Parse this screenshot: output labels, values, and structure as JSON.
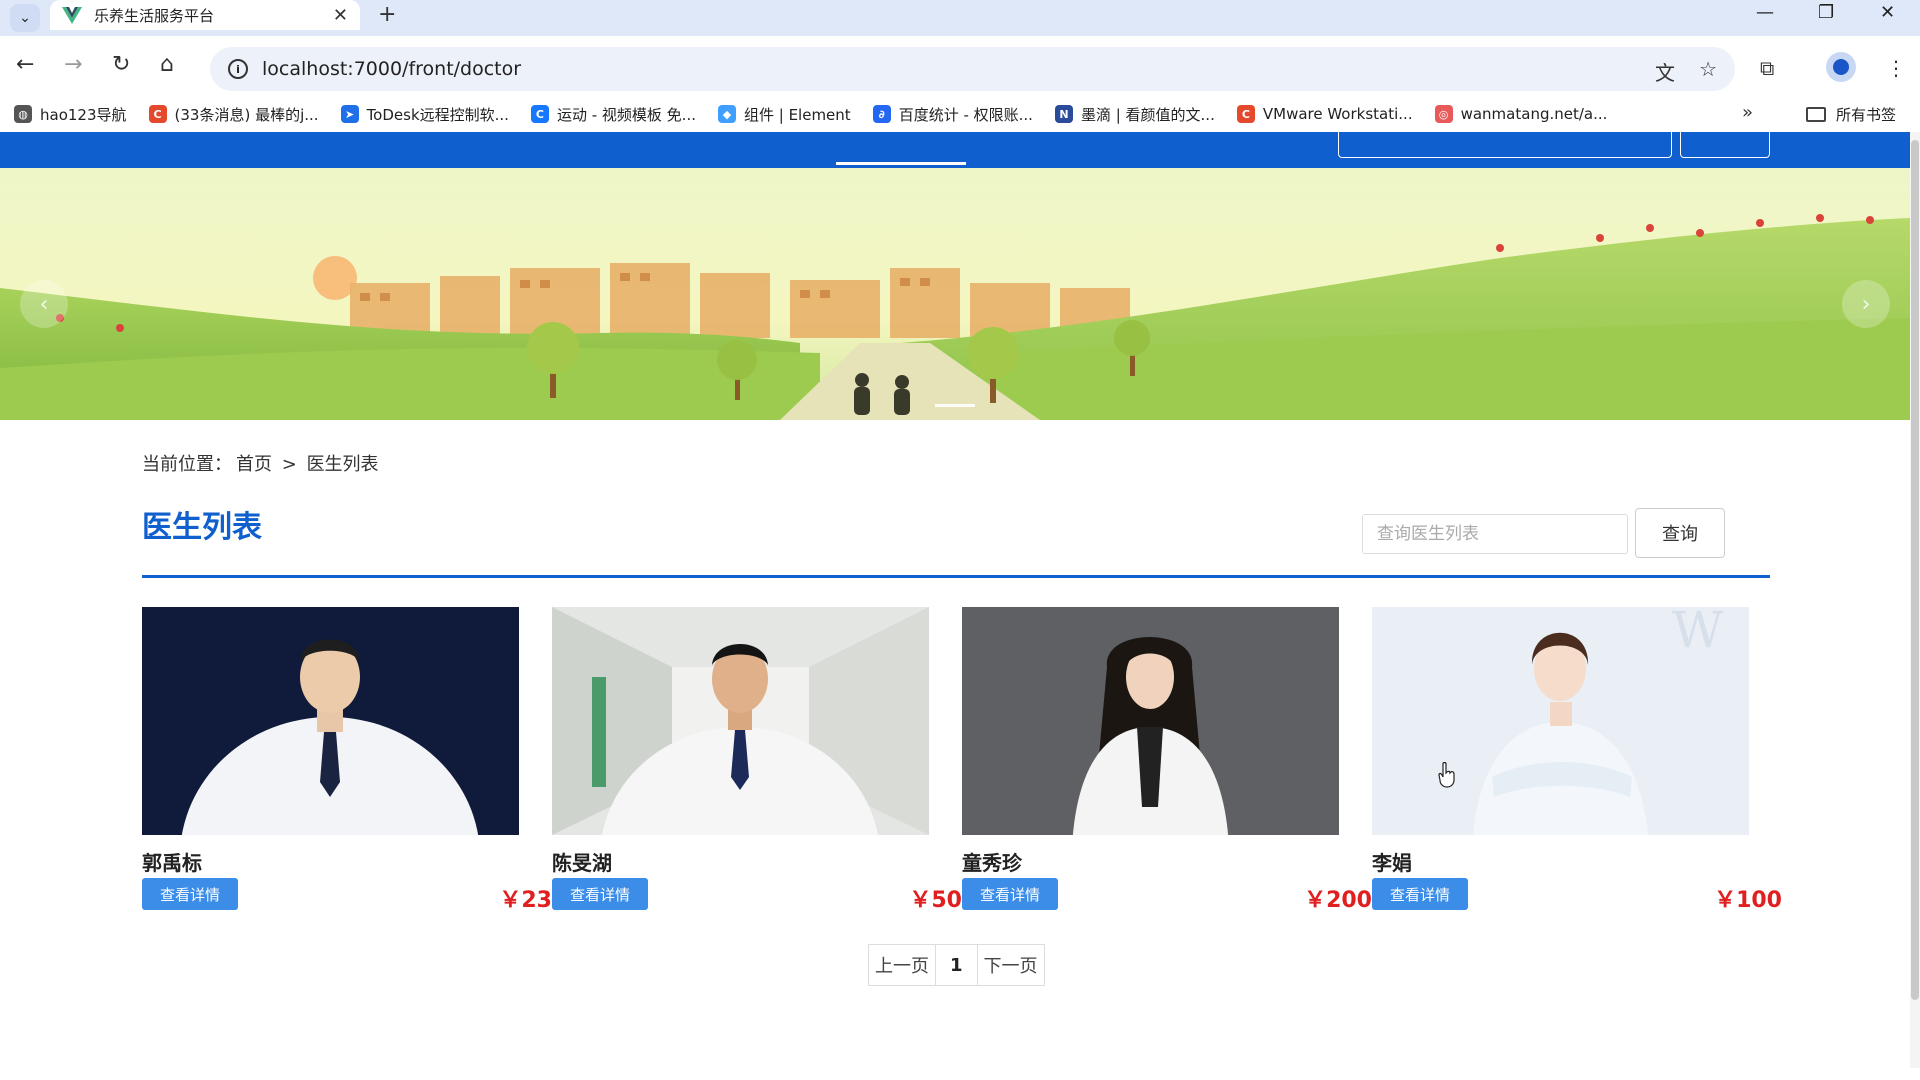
{
  "browser": {
    "tab_title": "乐养生活服务平台",
    "url": "localhost:7000/front/doctor",
    "bookmarks": [
      {
        "label": "hao123导航",
        "icon": "globe-icon",
        "color": "#555555"
      },
      {
        "label": "(33条消息) 最棒的j...",
        "icon": "csdn-icon",
        "color": "#e4492c"
      },
      {
        "label": "ToDesk远程控制软...",
        "icon": "todesk-icon",
        "color": "#1f6fe8"
      },
      {
        "label": "运动 - 视频模板 免...",
        "icon": "c-icon",
        "color": "#1677ff"
      },
      {
        "label": "组件 | Element",
        "icon": "element-icon",
        "color": "#409eff"
      },
      {
        "label": "百度统计 - 权限账...",
        "icon": "baidu-tongji-icon",
        "color": "#2468f2"
      },
      {
        "label": "墨滴 | 看颜值的文...",
        "icon": "modi-icon",
        "color": "#2b4c9b"
      },
      {
        "label": "VMware Workstati...",
        "icon": "csdn-icon",
        "color": "#e4492c"
      },
      {
        "label": "wanmatang.net/a...",
        "icon": "wanmatang-icon",
        "color": "#e85a5a"
      }
    ],
    "all_bookmarks": "所有书签"
  },
  "page": {
    "breadcrumb_prefix": "当前位置：",
    "breadcrumb_home": "首页",
    "breadcrumb_sep": ">",
    "breadcrumb_current": "医生列表",
    "title": "医生列表",
    "search_placeholder": "查询医生列表",
    "search_button": "查询",
    "pager": {
      "prev": "上一页",
      "current": "1",
      "next": "下一页"
    }
  },
  "doctors": [
    {
      "name": "郭禹标",
      "detail_label": "查看详情",
      "price": "￥23"
    },
    {
      "name": "陈旻湖",
      "detail_label": "查看详情",
      "price": "￥50"
    },
    {
      "name": "童秀珍",
      "detail_label": "查看详情",
      "price": "￥200"
    },
    {
      "name": "李娟",
      "detail_label": "查看详情",
      "price": "￥100"
    }
  ],
  "colors": {
    "brand_blue": "#0f5fce",
    "button_blue": "#3b8de8",
    "price_red": "#e02020"
  }
}
